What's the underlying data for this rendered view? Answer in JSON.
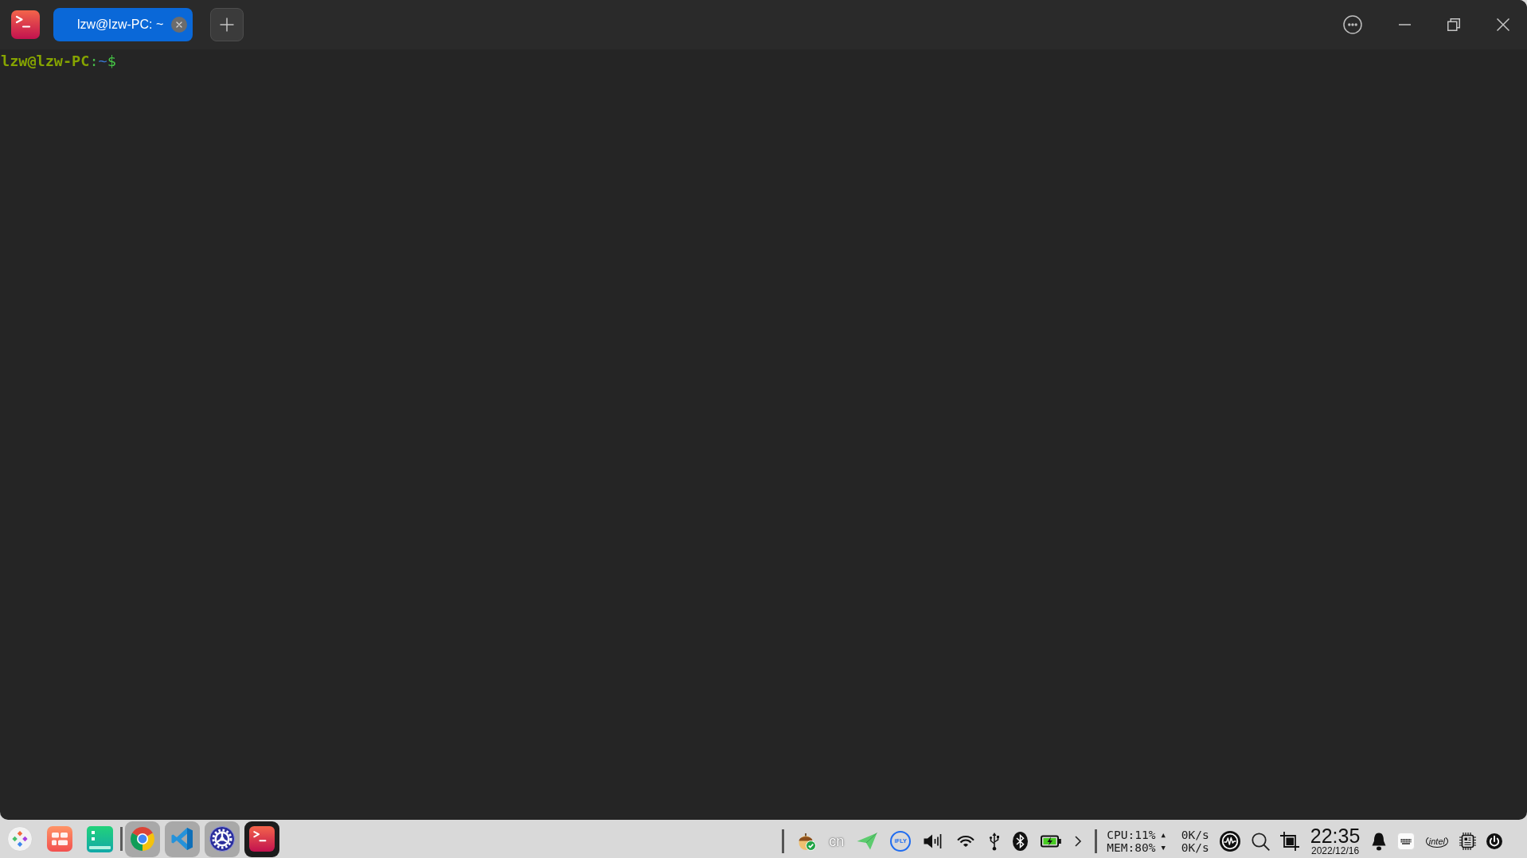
{
  "window": {
    "tabs": [
      {
        "label": "lzw@lzw-PC: ~",
        "selected": true
      }
    ]
  },
  "terminal": {
    "prompt": {
      "user_host": "lzw@lzw-PC",
      "separator": ":",
      "path": "~",
      "symbol": "$"
    }
  },
  "taskbar": {
    "system_items": [
      {
        "kind": "launcher"
      },
      {
        "kind": "store"
      },
      {
        "kind": "files"
      }
    ],
    "apps": [
      {
        "kind": "browser",
        "selected": false
      },
      {
        "kind": "editor",
        "selected": false
      },
      {
        "kind": "settings",
        "selected": false
      },
      {
        "kind": "terminal",
        "selected": true
      }
    ],
    "tray": {
      "input_method": "cn",
      "ime_logo": "iFLY",
      "cpu": "CPU:11%",
      "mem": "MEM:80%",
      "network": [
        {
          "arrow": "▲",
          "speed": "0K/s"
        },
        {
          "arrow": "▼",
          "speed": "0K/s"
        }
      ],
      "time": "22:35",
      "date": "2022/12/16",
      "cpu_vendor_logo": "intel"
    }
  }
}
